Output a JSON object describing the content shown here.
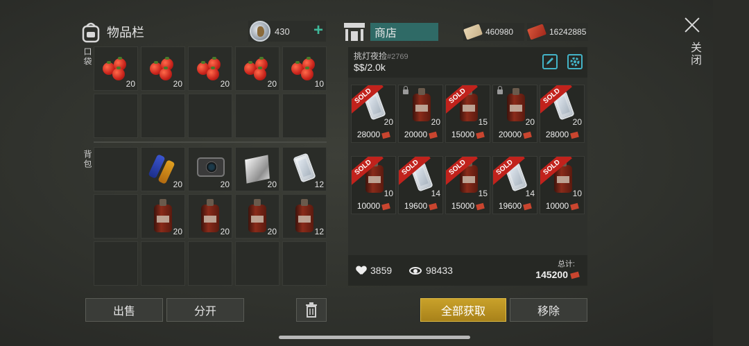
{
  "inventory": {
    "title": "物品栏",
    "coins": "430",
    "pocket_label": "口袋",
    "backpack_label": "背包",
    "pocket_items": [
      {
        "name": "tomato",
        "qty": "20"
      },
      {
        "name": "tomato",
        "qty": "20"
      },
      {
        "name": "tomato",
        "qty": "20"
      },
      {
        "name": "tomato",
        "qty": "20"
      },
      {
        "name": "tomato",
        "qty": "10"
      }
    ],
    "backpack_items": [
      {
        "name": "batteries",
        "qty": "20"
      },
      {
        "name": "camera",
        "qty": "20"
      },
      {
        "name": "steel-plate",
        "qty": "20"
      },
      {
        "name": "smartphone",
        "qty": "12"
      },
      {
        "name": "bottle",
        "qty": "20"
      },
      {
        "name": "bottle",
        "qty": "20"
      },
      {
        "name": "bottle",
        "qty": "20"
      },
      {
        "name": "bottle",
        "qty": "12"
      }
    ],
    "buttons": {
      "sell": "出售",
      "split": "分开"
    }
  },
  "shop": {
    "title": "商店",
    "currency_ticket": "460980",
    "currency_card": "16242885",
    "shop_name": "挑灯夜捡",
    "shop_id": "#2769",
    "price_rate": "$$/2.0k",
    "items": [
      {
        "item": "smartphone",
        "qty": "20",
        "price": "28000",
        "sold": true,
        "locked": false
      },
      {
        "item": "bottle",
        "qty": "20",
        "price": "20000",
        "sold": false,
        "locked": true
      },
      {
        "item": "bottle",
        "qty": "15",
        "price": "15000",
        "sold": true,
        "locked": false
      },
      {
        "item": "bottle",
        "qty": "20",
        "price": "20000",
        "sold": false,
        "locked": true
      },
      {
        "item": "smartphone",
        "qty": "20",
        "price": "28000",
        "sold": true,
        "locked": false
      },
      {
        "item": "bottle",
        "qty": "10",
        "price": "10000",
        "sold": true,
        "locked": false
      },
      {
        "item": "smartphone",
        "qty": "14",
        "price": "19600",
        "sold": true,
        "locked": false
      },
      {
        "item": "bottle",
        "qty": "15",
        "price": "15000",
        "sold": true,
        "locked": false
      },
      {
        "item": "smartphone",
        "qty": "14",
        "price": "19600",
        "sold": true,
        "locked": false
      },
      {
        "item": "bottle",
        "qty": "10",
        "price": "10000",
        "sold": true,
        "locked": false
      }
    ],
    "sold_label": "SOLD",
    "likes": "3859",
    "views": "98433",
    "total_label": "总计:",
    "total_value": "145200",
    "buttons": {
      "take_all": "全部获取",
      "remove": "移除"
    }
  },
  "close_label": "关闭",
  "colors": {
    "accent": "#43b4c8",
    "gold": "#c9a12a",
    "sold": "#c1221c",
    "shop_title_bg": "#2f6a66"
  }
}
